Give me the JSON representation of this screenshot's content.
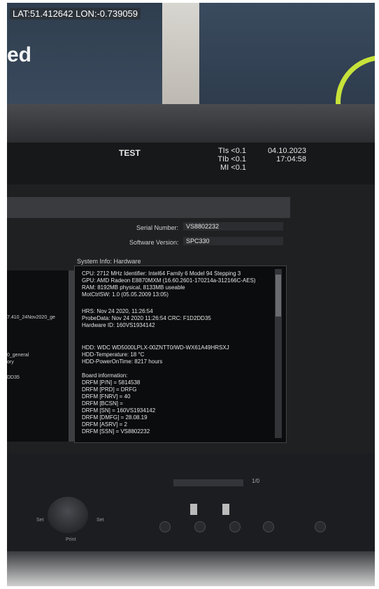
{
  "gps_overlay": "LAT:51.412642 LON:-0.739059",
  "banner_text": "ed",
  "monitor": {
    "title": "TEST",
    "indices": [
      "TIs <0.1",
      "TIb <0.1",
      "MI <0.1"
    ],
    "date": "04.10.2023",
    "time": "17:04:58",
    "serial_label": "Serial Number:",
    "serial_value": "VS8802232",
    "software_label": "Software Version:",
    "software_value": "SPC330",
    "sysinfo_title": "System Info: Hardware",
    "left_items": [
      "7.410_24Nov2020_ge",
      "0_general",
      "ory",
      "DD35"
    ],
    "info_lines": [
      "CPU: 2712 MHz Identifier: Intel64 Family 6 Model 94 Stepping 3",
      "GPU: AMD Radeon E8870MXM (16.60.2601-170214a-312166C-AES)",
      "RAM: 8192MB physical, 8133MB useable",
      "MotCtrlSW: 1.0 (05.05.2009 13:05)",
      "HRS: Nov 24 2020, 11:26:54",
      "ProbeData: Nov 24 2020  11:26:54  CRC: F1D2DD35",
      "Hardware ID: 160VS1934142",
      "HDD: WDC WD5000LPLX-00ZNTT0/WD-WX61A49HRSXJ",
      "HDD-Temperature: 18 °C",
      "HDD-PowerOnTime: 8217 hours",
      "Board information:",
      "DRFM [P/N] = 5814538",
      "DRFM [PRD] = DRFG",
      "DRFM [FNRV] = 40",
      "DRFM [BCSN] =",
      "DRFM [SN] = 160VS1934142",
      "DRFM [DMFG] = 28.08.19",
      "DRFM [ASRV] = 2",
      "DRFM [SSN] = VS8802232"
    ],
    "frame_counter": "1/0",
    "set_left": "Set",
    "set_right": "Set",
    "print_label": "Print"
  }
}
